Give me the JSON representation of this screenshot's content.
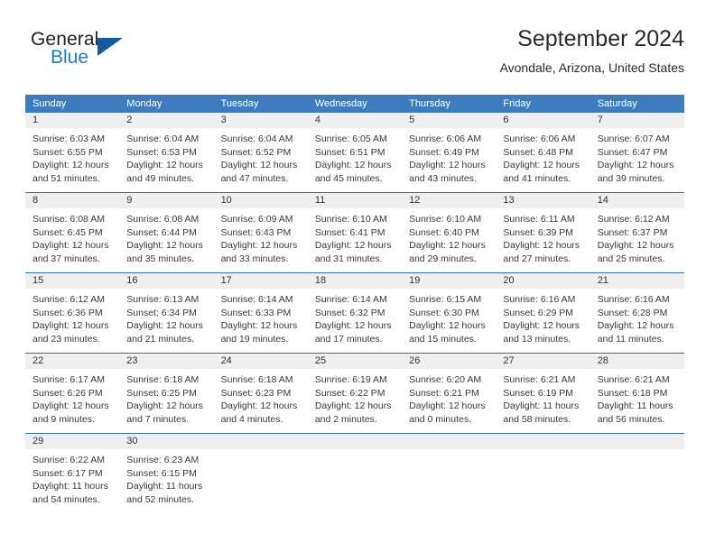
{
  "brand": {
    "word_one": "General",
    "word_two": "Blue",
    "icon": "triangle-logo"
  },
  "header": {
    "title": "September 2024",
    "location": "Avondale, Arizona, United States"
  },
  "colors": {
    "header_blue": "#3d7cbd",
    "row_divider_blue": "#2a6ead",
    "daynum_band": "#efefef",
    "brand_blue": "#1f7ac4",
    "brand_triangle": "#15599e",
    "text": "#3a3a3a"
  },
  "weekdays": [
    "Sunday",
    "Monday",
    "Tuesday",
    "Wednesday",
    "Thursday",
    "Friday",
    "Saturday"
  ],
  "weeks": [
    [
      {
        "day": "1",
        "lines": [
          "Sunrise: 6:03 AM",
          "Sunset: 6:55 PM",
          "Daylight: 12 hours",
          "and 51 minutes."
        ]
      },
      {
        "day": "2",
        "lines": [
          "Sunrise: 6:04 AM",
          "Sunset: 6:53 PM",
          "Daylight: 12 hours",
          "and 49 minutes."
        ]
      },
      {
        "day": "3",
        "lines": [
          "Sunrise: 6:04 AM",
          "Sunset: 6:52 PM",
          "Daylight: 12 hours",
          "and 47 minutes."
        ]
      },
      {
        "day": "4",
        "lines": [
          "Sunrise: 6:05 AM",
          "Sunset: 6:51 PM",
          "Daylight: 12 hours",
          "and 45 minutes."
        ]
      },
      {
        "day": "5",
        "lines": [
          "Sunrise: 6:06 AM",
          "Sunset: 6:49 PM",
          "Daylight: 12 hours",
          "and 43 minutes."
        ]
      },
      {
        "day": "6",
        "lines": [
          "Sunrise: 6:06 AM",
          "Sunset: 6:48 PM",
          "Daylight: 12 hours",
          "and 41 minutes."
        ]
      },
      {
        "day": "7",
        "lines": [
          "Sunrise: 6:07 AM",
          "Sunset: 6:47 PM",
          "Daylight: 12 hours",
          "and 39 minutes."
        ]
      }
    ],
    [
      {
        "day": "8",
        "lines": [
          "Sunrise: 6:08 AM",
          "Sunset: 6:45 PM",
          "Daylight: 12 hours",
          "and 37 minutes."
        ]
      },
      {
        "day": "9",
        "lines": [
          "Sunrise: 6:08 AM",
          "Sunset: 6:44 PM",
          "Daylight: 12 hours",
          "and 35 minutes."
        ]
      },
      {
        "day": "10",
        "lines": [
          "Sunrise: 6:09 AM",
          "Sunset: 6:43 PM",
          "Daylight: 12 hours",
          "and 33 minutes."
        ]
      },
      {
        "day": "11",
        "lines": [
          "Sunrise: 6:10 AM",
          "Sunset: 6:41 PM",
          "Daylight: 12 hours",
          "and 31 minutes."
        ]
      },
      {
        "day": "12",
        "lines": [
          "Sunrise: 6:10 AM",
          "Sunset: 6:40 PM",
          "Daylight: 12 hours",
          "and 29 minutes."
        ]
      },
      {
        "day": "13",
        "lines": [
          "Sunrise: 6:11 AM",
          "Sunset: 6:39 PM",
          "Daylight: 12 hours",
          "and 27 minutes."
        ]
      },
      {
        "day": "14",
        "lines": [
          "Sunrise: 6:12 AM",
          "Sunset: 6:37 PM",
          "Daylight: 12 hours",
          "and 25 minutes."
        ]
      }
    ],
    [
      {
        "day": "15",
        "lines": [
          "Sunrise: 6:12 AM",
          "Sunset: 6:36 PM",
          "Daylight: 12 hours",
          "and 23 minutes."
        ]
      },
      {
        "day": "16",
        "lines": [
          "Sunrise: 6:13 AM",
          "Sunset: 6:34 PM",
          "Daylight: 12 hours",
          "and 21 minutes."
        ]
      },
      {
        "day": "17",
        "lines": [
          "Sunrise: 6:14 AM",
          "Sunset: 6:33 PM",
          "Daylight: 12 hours",
          "and 19 minutes."
        ]
      },
      {
        "day": "18",
        "lines": [
          "Sunrise: 6:14 AM",
          "Sunset: 6:32 PM",
          "Daylight: 12 hours",
          "and 17 minutes."
        ]
      },
      {
        "day": "19",
        "lines": [
          "Sunrise: 6:15 AM",
          "Sunset: 6:30 PM",
          "Daylight: 12 hours",
          "and 15 minutes."
        ]
      },
      {
        "day": "20",
        "lines": [
          "Sunrise: 6:16 AM",
          "Sunset: 6:29 PM",
          "Daylight: 12 hours",
          "and 13 minutes."
        ]
      },
      {
        "day": "21",
        "lines": [
          "Sunrise: 6:16 AM",
          "Sunset: 6:28 PM",
          "Daylight: 12 hours",
          "and 11 minutes."
        ]
      }
    ],
    [
      {
        "day": "22",
        "lines": [
          "Sunrise: 6:17 AM",
          "Sunset: 6:26 PM",
          "Daylight: 12 hours",
          "and 9 minutes."
        ]
      },
      {
        "day": "23",
        "lines": [
          "Sunrise: 6:18 AM",
          "Sunset: 6:25 PM",
          "Daylight: 12 hours",
          "and 7 minutes."
        ]
      },
      {
        "day": "24",
        "lines": [
          "Sunrise: 6:18 AM",
          "Sunset: 6:23 PM",
          "Daylight: 12 hours",
          "and 4 minutes."
        ]
      },
      {
        "day": "25",
        "lines": [
          "Sunrise: 6:19 AM",
          "Sunset: 6:22 PM",
          "Daylight: 12 hours",
          "and 2 minutes."
        ]
      },
      {
        "day": "26",
        "lines": [
          "Sunrise: 6:20 AM",
          "Sunset: 6:21 PM",
          "Daylight: 12 hours",
          "and 0 minutes."
        ]
      },
      {
        "day": "27",
        "lines": [
          "Sunrise: 6:21 AM",
          "Sunset: 6:19 PM",
          "Daylight: 11 hours",
          "and 58 minutes."
        ]
      },
      {
        "day": "28",
        "lines": [
          "Sunrise: 6:21 AM",
          "Sunset: 6:18 PM",
          "Daylight: 11 hours",
          "and 56 minutes."
        ]
      }
    ],
    [
      {
        "day": "29",
        "lines": [
          "Sunrise: 6:22 AM",
          "Sunset: 6:17 PM",
          "Daylight: 11 hours",
          "and 54 minutes."
        ]
      },
      {
        "day": "30",
        "lines": [
          "Sunrise: 6:23 AM",
          "Sunset: 6:15 PM",
          "Daylight: 11 hours",
          "and 52 minutes."
        ]
      },
      {
        "day": "",
        "lines": []
      },
      {
        "day": "",
        "lines": []
      },
      {
        "day": "",
        "lines": []
      },
      {
        "day": "",
        "lines": []
      },
      {
        "day": "",
        "lines": []
      }
    ]
  ]
}
